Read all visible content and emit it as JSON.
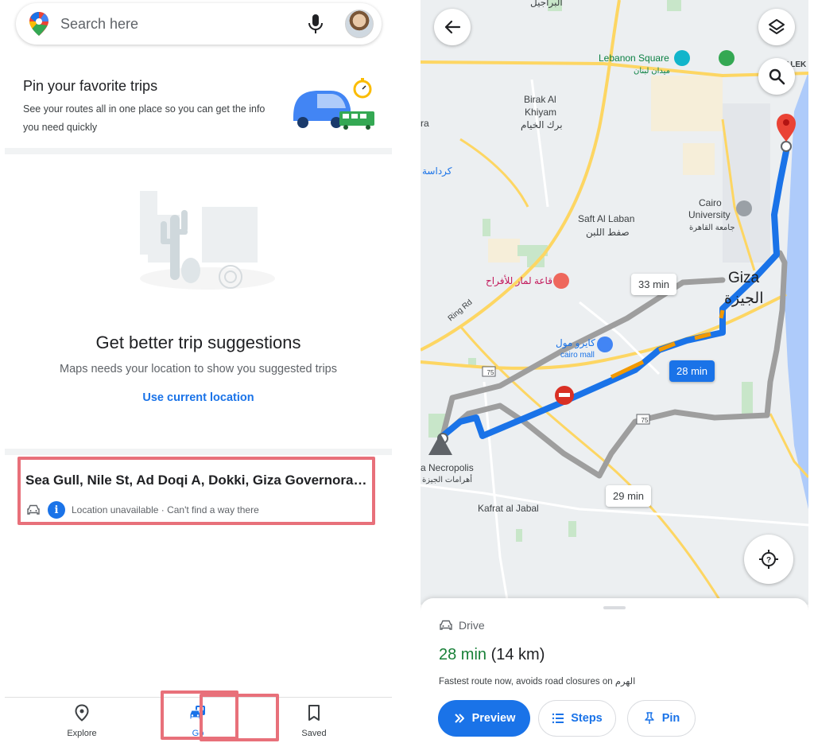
{
  "left_panel": {
    "search": {
      "placeholder": "Search here"
    },
    "pin_promo": {
      "title": "Pin your favorite trips",
      "description": "See your routes all in one place so you can get the info you need quickly"
    },
    "empty_state": {
      "headline": "Get better trip suggestions",
      "subtext": "Maps needs your location to show you suggested trips",
      "link": "Use current location"
    },
    "trip": {
      "address": "Sea Gull, Nile St, Ad Doqi A, Dokki, Giza Governorat...",
      "status": "Location unavailable · Can't find a way there",
      "info_glyph": "i"
    },
    "nav": [
      {
        "label": "Explore",
        "icon": "location-pin-icon"
      },
      {
        "label": "Go",
        "icon": "car-bus-icon",
        "selected": true
      },
      {
        "label": "Saved",
        "icon": "bookmark-icon"
      }
    ]
  },
  "right_panel": {
    "map_labels": {
      "top_arabic": "البراجيل",
      "lebanon_square": "Lebanon Square",
      "lebanon_square_ar": "ميدان لبنان",
      "birak_1": "Birak Al",
      "birak_2": "Khiyam",
      "birak_ar": "برك الخيام",
      "karadasa_ar": "كرداسة",
      "ra": "ra",
      "saft_al_laban": "Saft Al Laban",
      "saft_al_laban_ar": "صفط اللبن",
      "cairo_uni_1": "Cairo",
      "cairo_uni_2": "University",
      "cairo_uni_ar": "جامعة القاهرة",
      "venue_ar": "قاعة لمار للأفراح",
      "giza": "Giza",
      "giza_ar": "الجيزة",
      "ring_rd": "Ring Rd",
      "cairo_mall_ar": "كايرو مول",
      "cairo_mall": "cairo mall",
      "necropolis": "a Necropolis",
      "necropolis_ar": "أهرامات الجيزة",
      "kafrat": "Kafrat al Jabal",
      "road_75a": "75",
      "road_75b": "75",
      "alek": "ALEK"
    },
    "route_times": {
      "primary": "28 min",
      "alt1": "33 min",
      "alt2": "29 min"
    },
    "sheet": {
      "mode": "Drive",
      "eta_time": "28 min",
      "eta_distance": "(14 km)",
      "note": "Fastest route now, avoids road closures on الهرم",
      "buttons": {
        "preview": "Preview",
        "steps": "Steps",
        "pin": "Pin"
      }
    },
    "colors": {
      "route_primary": "#1a73e8",
      "route_alt": "#9e9e9e",
      "highlight": "#e8707a",
      "eta_green": "#188038"
    }
  }
}
